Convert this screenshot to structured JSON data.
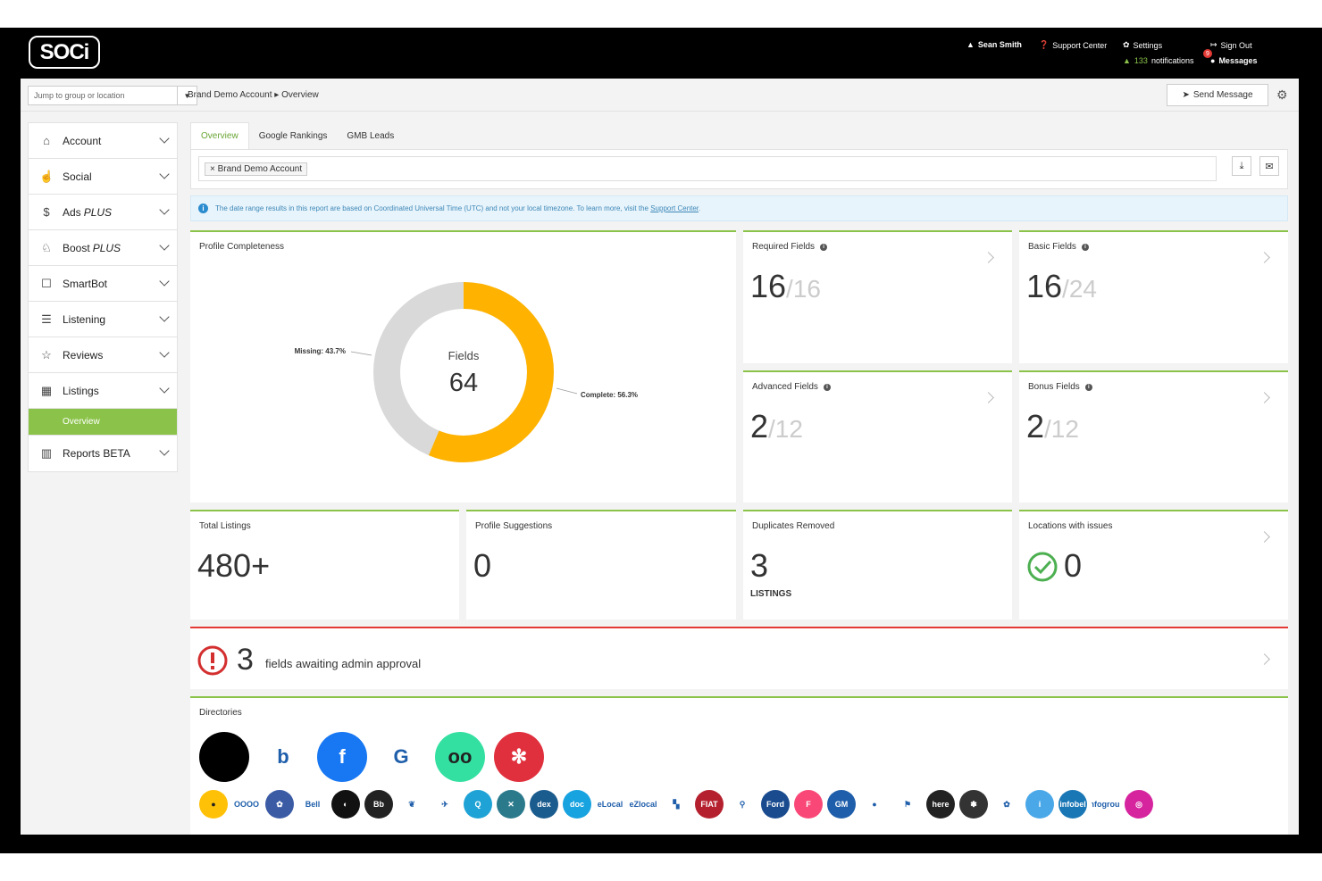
{
  "topbar": {
    "logo": "SOCi",
    "user": "Sean Smith",
    "support": "Support Center",
    "settings": "Settings",
    "signout": "Sign Out",
    "notifications_count": "133",
    "notifications_label": "notifications",
    "messages_badge": "9",
    "messages": "Messages"
  },
  "subheader": {
    "jump_placeholder": "Jump to group or location",
    "breadcrumb": "Brand Demo Account ▸ Overview",
    "send_message": "Send Message"
  },
  "sidebar": {
    "items": [
      {
        "label": "Account",
        "icon": "home-icon"
      },
      {
        "label": "Social",
        "icon": "thumbs-up-icon"
      },
      {
        "label": "Ads",
        "suffix": "PLUS",
        "icon": "dollar-icon"
      },
      {
        "label": "Boost",
        "suffix": "PLUS",
        "icon": "rocket-icon"
      },
      {
        "label": "SmartBot",
        "icon": "robot-icon"
      },
      {
        "label": "Listening",
        "icon": "chat-icon"
      },
      {
        "label": "Reviews",
        "icon": "star-icon"
      },
      {
        "label": "Listings",
        "icon": "store-icon"
      },
      {
        "label": "Reports BETA",
        "icon": "bar-chart-icon"
      }
    ],
    "active_sub": "Overview"
  },
  "tabs": [
    "Overview",
    "Google Rankings",
    "GMB Leads"
  ],
  "filter": {
    "chip": "× Brand Demo Account"
  },
  "info": {
    "text": "The date range results in this report are based on Coordinated Universal Time (UTC) and not your local timezone. To learn more, visit the",
    "link": "Support Center",
    "end": "."
  },
  "profile": {
    "title": "Profile Completeness",
    "center_label": "Fields",
    "center_value": "64",
    "missing_label": "Missing: 43.7%",
    "complete_label": "Complete: 56.3%",
    "complete_pct": 56.3,
    "missing_pct": 43.7,
    "colors": {
      "complete": "#ffb300",
      "missing": "#d9d9d9"
    }
  },
  "fields": {
    "required": {
      "title": "Required Fields",
      "value": "16",
      "total": "/16"
    },
    "basic": {
      "title": "Basic Fields",
      "value": "16",
      "total": "/24"
    },
    "advanced": {
      "title": "Advanced Fields",
      "value": "2",
      "total": "/12"
    },
    "bonus": {
      "title": "Bonus Fields",
      "value": "2",
      "total": "/12"
    }
  },
  "stats": {
    "total_listings": {
      "title": "Total Listings",
      "value": "480+"
    },
    "profile_suggestions": {
      "title": "Profile Suggestions",
      "value": "0"
    },
    "duplicates": {
      "title": "Duplicates Removed",
      "value": "3",
      "sub": "LISTINGS"
    },
    "issues": {
      "title": "Locations with issues",
      "value": "0"
    }
  },
  "approval": {
    "value": "3",
    "text": "fields awaiting admin approval"
  },
  "directories": {
    "title": "Directories",
    "row1": [
      {
        "name": "apple-icon",
        "glyph": "",
        "color": "#000000"
      },
      {
        "name": "bing-icon",
        "glyph": "b",
        "color": "#ffffff"
      },
      {
        "name": "facebook-icon",
        "glyph": "f",
        "color": "#1877f2"
      },
      {
        "name": "google-business-icon",
        "glyph": "G",
        "color": "#ffffff"
      },
      {
        "name": "tripadvisor-icon",
        "glyph": "oo",
        "color": "#34e0a1"
      },
      {
        "name": "yelp-icon",
        "glyph": "✻",
        "color": "#e0303d"
      }
    ],
    "row2": [
      {
        "name": "lightbulb-icon",
        "glyph": "●",
        "color": "#ffc107"
      },
      {
        "name": "audi-icon",
        "glyph": "OOOO",
        "color": "#ffffff"
      },
      {
        "name": "paw-icon",
        "glyph": "✿",
        "color": "#3b5ba5"
      },
      {
        "name": "bell-icon",
        "glyph": "Bell",
        "color": "#ffffff"
      },
      {
        "name": "bmw-icon",
        "glyph": "◐",
        "color": "#111111"
      },
      {
        "name": "bb-icon",
        "glyph": "Bb",
        "color": "#222222"
      },
      {
        "name": "leaf-icon",
        "glyph": "❦",
        "color": "#ffffff"
      },
      {
        "name": "chevrolet-icon",
        "glyph": "✈",
        "color": "#ffffff"
      },
      {
        "name": "q-icon",
        "glyph": "Q",
        "color": "#1fa3d6"
      },
      {
        "name": "cross-icon",
        "glyph": "✕",
        "color": "#2b7a8c"
      },
      {
        "name": "dexknows-icon",
        "glyph": "dex",
        "color": "#1b5c8e"
      },
      {
        "name": "docinfo-icon",
        "glyph": "doc",
        "color": "#17a2e0"
      },
      {
        "name": "elocal-icon",
        "glyph": "eLocal",
        "color": "#ffffff"
      },
      {
        "name": "ezlocal-icon",
        "glyph": "eZlocal",
        "color": "#ffffff"
      },
      {
        "name": "squares-icon",
        "glyph": "▚",
        "color": "#ffffff"
      },
      {
        "name": "fiat-icon",
        "glyph": "FIAT",
        "color": "#b5202e"
      },
      {
        "name": "pin-icon",
        "glyph": "⚲",
        "color": "#ffffff"
      },
      {
        "name": "ford-icon",
        "glyph": "Ford",
        "color": "#1a4b8f"
      },
      {
        "name": "foursquare-icon",
        "glyph": "F",
        "color": "#f94877"
      },
      {
        "name": "gm-icon",
        "glyph": "GM",
        "color": "#1f5eaa"
      },
      {
        "name": "google-assistant-icon",
        "glyph": "●",
        "color": "#ffffff"
      },
      {
        "name": "google-maps-icon",
        "glyph": "⚑",
        "color": "#ffffff"
      },
      {
        "name": "here-icon",
        "glyph": "here",
        "color": "#222222"
      },
      {
        "name": "hotfrog-icon",
        "glyph": "✽",
        "color": "#333333"
      },
      {
        "name": "huawei-icon",
        "glyph": "✿",
        "color": "#ffffff"
      },
      {
        "name": "info-circle-icon",
        "glyph": "i",
        "color": "#4aa8e8"
      },
      {
        "name": "infobel-icon",
        "glyph": "infobel",
        "color": "#1a77b5"
      },
      {
        "name": "infogroup-icon",
        "glyph": "infogroup",
        "color": "#ffffff"
      },
      {
        "name": "instagram-icon",
        "glyph": "◎",
        "color": "#d6249f"
      }
    ]
  }
}
